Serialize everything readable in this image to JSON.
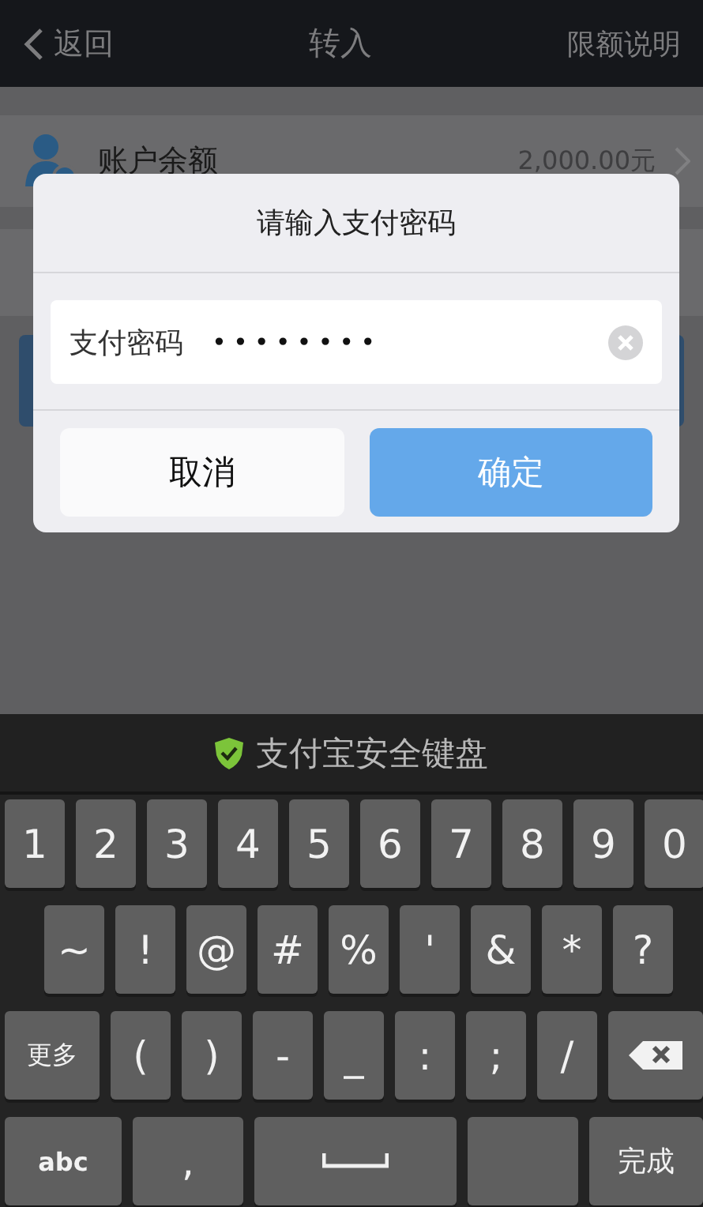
{
  "header": {
    "back_label": "返回",
    "title": "转入",
    "action": "限额说明"
  },
  "balance_row": {
    "label": "账户余额",
    "amount": "2,000.00元"
  },
  "dialog": {
    "title": "请输入支付密码",
    "field_label": "支付密码",
    "value": "••••••••",
    "buttons": [
      {
        "label": "取消",
        "kind": "secondary"
      },
      {
        "label": "确定",
        "kind": "primary"
      }
    ]
  },
  "keyboard": {
    "title": "支付宝安全键盘",
    "rows": [
      [
        {
          "label": "1",
          "kind": "char"
        },
        {
          "label": "2",
          "kind": "char"
        },
        {
          "label": "3",
          "kind": "char"
        },
        {
          "label": "4",
          "kind": "char"
        },
        {
          "label": "5",
          "kind": "char"
        },
        {
          "label": "6",
          "kind": "char"
        },
        {
          "label": "7",
          "kind": "char"
        },
        {
          "label": "8",
          "kind": "char"
        },
        {
          "label": "9",
          "kind": "char"
        },
        {
          "label": "0",
          "kind": "char"
        }
      ],
      [
        {
          "label": "~",
          "kind": "char"
        },
        {
          "label": "!",
          "kind": "char"
        },
        {
          "label": "@",
          "kind": "char"
        },
        {
          "label": "#",
          "kind": "char"
        },
        {
          "label": "%",
          "kind": "char"
        },
        {
          "label": "'",
          "kind": "char"
        },
        {
          "label": "&",
          "kind": "char"
        },
        {
          "label": "*",
          "kind": "char"
        },
        {
          "label": "?",
          "kind": "char"
        }
      ],
      [
        {
          "label": "更多",
          "kind": "wide"
        },
        {
          "label": "(",
          "kind": "char"
        },
        {
          "label": ")",
          "kind": "char"
        },
        {
          "label": "-",
          "kind": "char"
        },
        {
          "label": "_",
          "kind": "char"
        },
        {
          "label": ":",
          "kind": "char"
        },
        {
          "label": ";",
          "kind": "char"
        },
        {
          "label": "/",
          "kind": "char"
        },
        {
          "kind": "backspace"
        }
      ],
      [
        {
          "label": "abc",
          "kind": "mode"
        },
        {
          "label": ",",
          "kind": "comma"
        },
        {
          "kind": "space"
        },
        {
          "kind": "blank"
        },
        {
          "label": "完成",
          "kind": "done"
        }
      ]
    ]
  }
}
